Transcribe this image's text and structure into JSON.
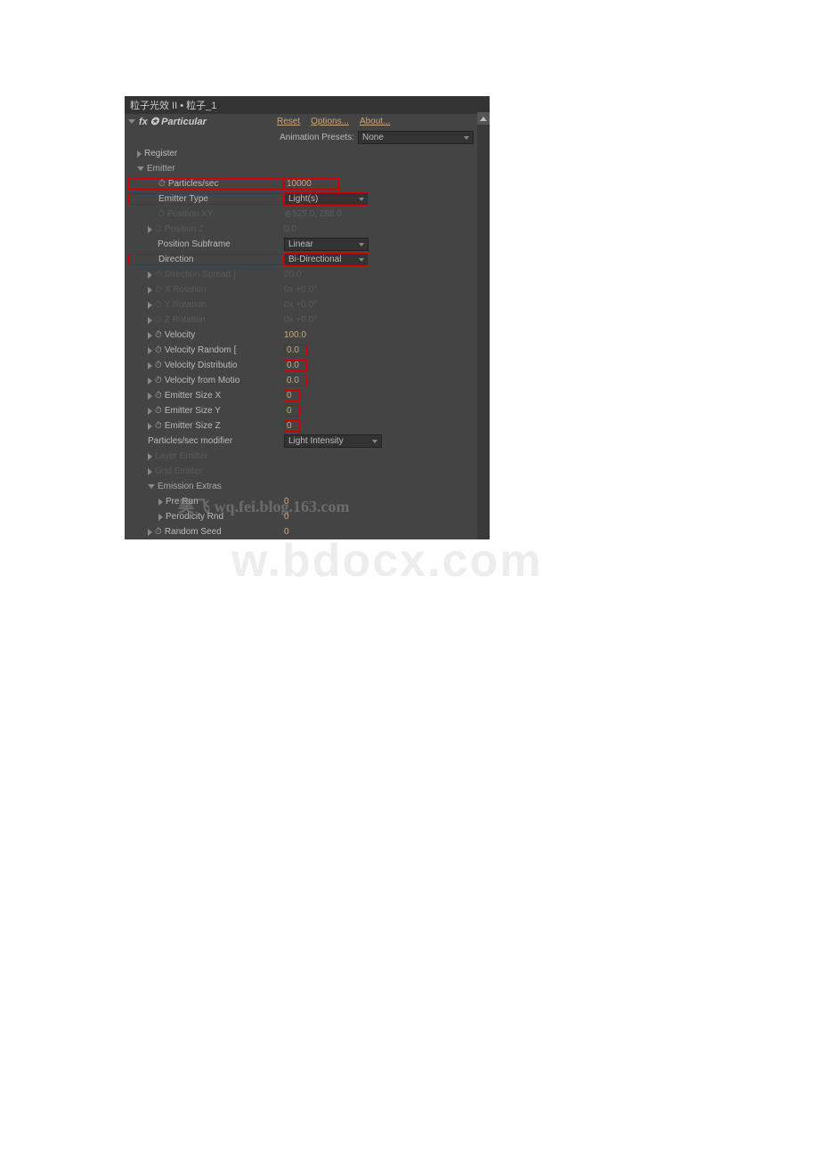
{
  "header": "粒子光效 II • 粒子_1",
  "fx": {
    "badge": "fx",
    "name": "Particular",
    "reset": "Reset",
    "options": "Options...",
    "about": "About..."
  },
  "preset": {
    "label": "Animation Presets:",
    "value": "None"
  },
  "register": "Register",
  "emitter": {
    "title": "Emitter",
    "props": [
      {
        "n": "Particles/sec",
        "v": "10000",
        "red": true
      },
      {
        "n": "Emitter Type",
        "v": "Light(s)",
        "dd": true,
        "red": true
      },
      {
        "n": "Position XY",
        "v": "525.0, 288.0",
        "dim": true,
        "xy": true
      },
      {
        "n": "Position Z",
        "v": "0.0",
        "dim": true,
        "tw": true
      },
      {
        "n": "Position Subframe",
        "v": "Linear",
        "dd": true
      },
      {
        "n": "Direction",
        "v": "Bi-Directional",
        "dd": true,
        "red": true
      },
      {
        "n": "Direction Spread [",
        "v": "20.0",
        "dim": true,
        "tw": true
      },
      {
        "n": "X Rotation",
        "v": "0x +0.0°",
        "dim": true,
        "tw": true
      },
      {
        "n": "Y Rotation",
        "v": "0x +0.0°",
        "dim": true,
        "tw": true
      },
      {
        "n": "Z Rotation",
        "v": "0x +0.0°",
        "dim": true,
        "tw": true
      },
      {
        "n": "Velocity",
        "v": "100.0",
        "tw": true
      },
      {
        "n": "Velocity Random [",
        "v": "0.0",
        "red2": true,
        "tw": true
      },
      {
        "n": "Velocity Distributio",
        "v": "0.0",
        "red2": true,
        "tw": true
      },
      {
        "n": "Velocity from Motio",
        "v": "0.0",
        "red2": true,
        "tw": true
      },
      {
        "n": "Emitter Size X",
        "v": "0",
        "red2": true,
        "tw": true
      },
      {
        "n": "Emitter Size Y",
        "v": "0",
        "red2": true,
        "tw": true
      },
      {
        "n": "Emitter Size Z",
        "v": "0",
        "red2": true,
        "tw": true
      }
    ],
    "modifier": {
      "n": "Particles/sec modifier",
      "v": "Light Intensity"
    },
    "layer": "Layer Emitter",
    "grid": "Grid Emitter",
    "extras": {
      "title": "Emission Extras",
      "props": [
        {
          "n": "Pre Run",
          "v": "0"
        },
        {
          "n": "Perodicity Rnd",
          "v": "0"
        }
      ]
    },
    "seed": {
      "n": "Random Seed",
      "v": "0"
    }
  },
  "watermarks": {
    "blog": "昊飞 wq.fei.blog.163.com",
    "site": "w.bdocx.com"
  }
}
